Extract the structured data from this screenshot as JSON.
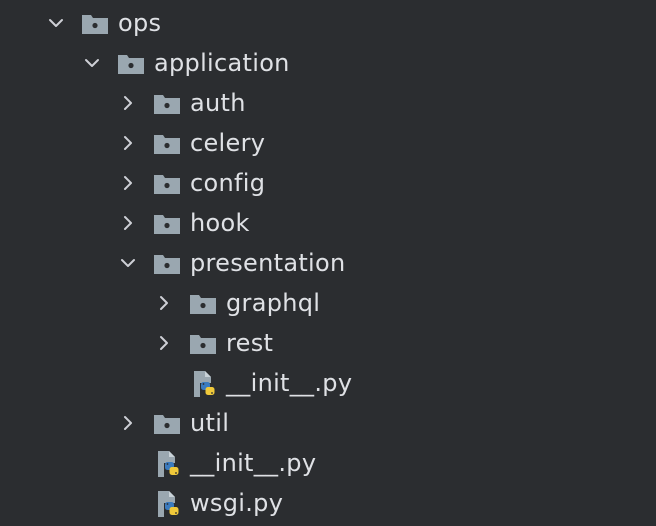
{
  "tree": {
    "nodes": [
      {
        "label": "ops",
        "type": "folder",
        "expanded": true
      },
      {
        "label": "application",
        "type": "folder",
        "expanded": true
      },
      {
        "label": "auth",
        "type": "folder",
        "expanded": false
      },
      {
        "label": "celery",
        "type": "folder",
        "expanded": false
      },
      {
        "label": "config",
        "type": "folder",
        "expanded": false
      },
      {
        "label": "hook",
        "type": "folder",
        "expanded": false
      },
      {
        "label": "presentation",
        "type": "folder",
        "expanded": true
      },
      {
        "label": "graphql",
        "type": "folder",
        "expanded": false
      },
      {
        "label": "rest",
        "type": "folder",
        "expanded": false
      },
      {
        "label": "__init__.py",
        "type": "python-file"
      },
      {
        "label": "util",
        "type": "folder",
        "expanded": false
      },
      {
        "label": "__init__.py",
        "type": "python-file"
      },
      {
        "label": "wsgi.py",
        "type": "python-file"
      }
    ]
  },
  "colors": {
    "background": "#2b2d30",
    "text": "#dfe1e5",
    "folder": "#9aa7b0",
    "chevron": "#ced0d6",
    "python_blue": "#3b7bbf",
    "python_yellow": "#f0c93a"
  }
}
